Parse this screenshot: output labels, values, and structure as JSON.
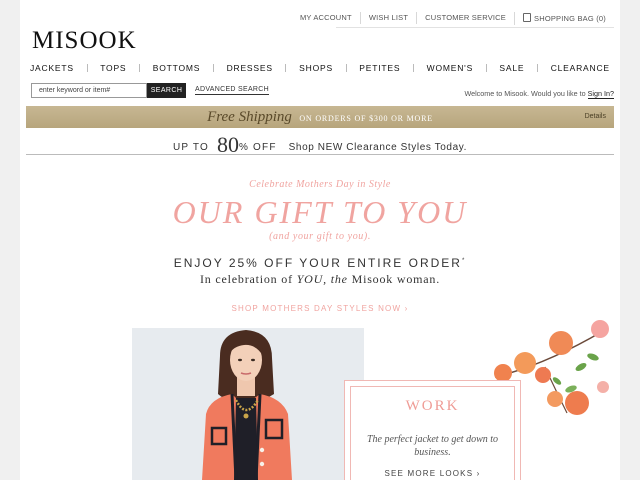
{
  "header": {
    "util_links": [
      "MY ACCOUNT",
      "WISH LIST",
      "CUSTOMER SERVICE"
    ],
    "bag_label": "SHOPPING BAG",
    "bag_count": "(0)",
    "logo": "MISOOK"
  },
  "nav": [
    "JACKETS",
    "TOPS",
    "BOTTOMS",
    "DRESSES",
    "SHOPS",
    "PETITES",
    "WOMEN'S",
    "SALE",
    "CLEARANCE"
  ],
  "search": {
    "placeholder": "enter keyword or item#",
    "button": "SEARCH",
    "advanced": "ADVANCED SEARCH"
  },
  "welcome": {
    "text": "Welcome to Misook. Would you like to",
    "signin": "Sign In?"
  },
  "shipping": {
    "free": "Free Shipping",
    "orders": "ON ORDERS OF $300 OR MORE",
    "details": "Details"
  },
  "clearance": {
    "up_to": "UP TO",
    "percent": "80",
    "off": "% OFF",
    "shop": "Shop NEW Clearance Styles Today."
  },
  "hero": {
    "kicker": "Celebrate Mothers Day in Style",
    "title": "OUR GIFT TO YOU",
    "subtitle": "(and your gift to you).",
    "enjoy": "ENJOY 25% OFF YOUR ENTIRE ORDER",
    "enjoy_mark": "*",
    "celebrate_pre": "In celebration of",
    "celebrate_you": "YOU,",
    "celebrate_the": "the",
    "celebrate_post": "Misook woman.",
    "cta": "SHOP MOTHERS DAY STYLES NOW ›"
  },
  "work_card": {
    "title": "WORK",
    "description": "The perfect jacket to get down to business.",
    "cta": "SEE MORE LOOKS ›"
  },
  "colors": {
    "accent_pink": "#f0a4a0",
    "gold_banner": "#bfae86",
    "jacket_coral": "#f07a5e"
  }
}
